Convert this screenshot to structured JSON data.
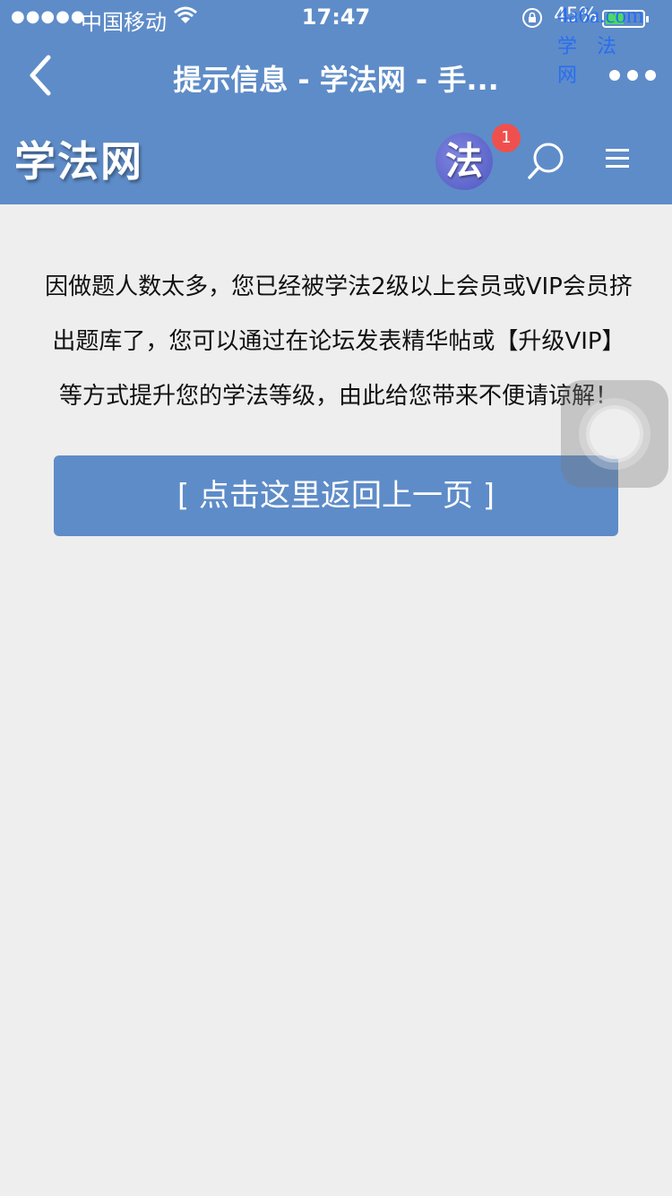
{
  "status_bar": {
    "signal": "●●●●●",
    "carrier": "中国移动",
    "time": "17:47",
    "battery_percent": "45%",
    "icons": [
      "wifi-icon",
      "rotation-lock-icon",
      "battery-icon"
    ]
  },
  "watermark": {
    "url": "4a6a.com",
    "name": "学法网"
  },
  "nav": {
    "title": "提示信息 - 学法网 - 手...",
    "back_icon": "chevron-left-icon",
    "more_icon": "more-dots-icon"
  },
  "header": {
    "logo": "学法网",
    "badge_char": "法",
    "notification_count": "1",
    "search_icon": "search-icon",
    "menu_icon": "hamburger-menu-icon"
  },
  "content": {
    "message_lines": [
      "因做题人数太多，您已经被学法2级以上会员或VIP会员挤",
      "出题库了，您可以通过在论坛发表精华帖或【升级VIP】",
      "等方式提升您的学法等级，由此给您带来不便请谅解！"
    ],
    "return_button": "[ 点击这里返回上一页 ]"
  },
  "colors": {
    "primary": "#5e8cc8",
    "background": "#eeeeee",
    "notification": "#f0504d",
    "watermark": "#2a6df0"
  }
}
